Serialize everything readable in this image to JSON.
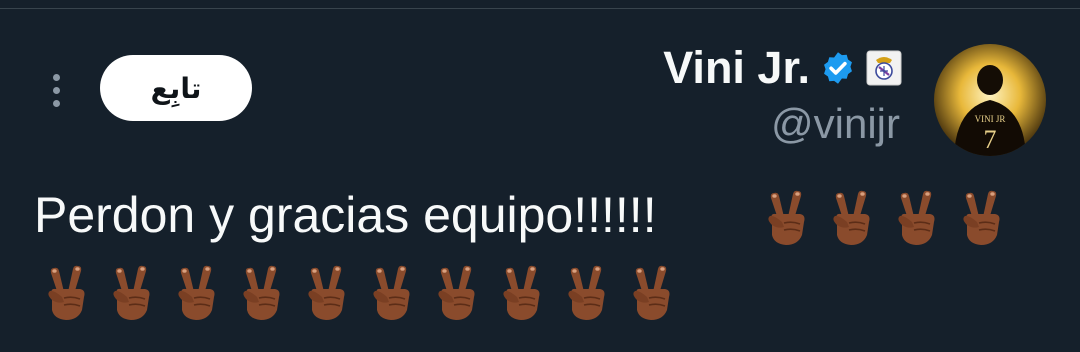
{
  "profile": {
    "display_name": "Vini Jr.",
    "handle": "@vinijr",
    "verified": true,
    "avatar_jersey_text": "VINI JR",
    "avatar_jersey_number": "7"
  },
  "actions": {
    "follow_label": "تابِع"
  },
  "tweet": {
    "text": "Perdon y gracias equipo!!!!!!",
    "emoji_line1": [
      "✌🏾",
      "✌🏾",
      "✌🏾",
      "✌🏾"
    ],
    "emoji_line2": [
      "✌🏾",
      "✌🏾",
      "✌🏾",
      "✌🏾",
      "✌🏾",
      "✌🏾",
      "✌🏾",
      "✌🏾",
      "✌🏾",
      "✌🏾"
    ]
  },
  "colors": {
    "background": "#15202b",
    "text_primary": "#f7f9f9",
    "text_secondary": "#8b98a5",
    "verified_blue": "#1d9bf0",
    "follow_button_bg": "#ffffff",
    "emoji_skin": "#8a4b2c"
  },
  "icons": {
    "more": "more-vertical-icon",
    "verified": "verified-badge-icon",
    "affiliation": "club-crest-icon",
    "emoji": "victory-hand-medium-dark-skin-tone"
  }
}
